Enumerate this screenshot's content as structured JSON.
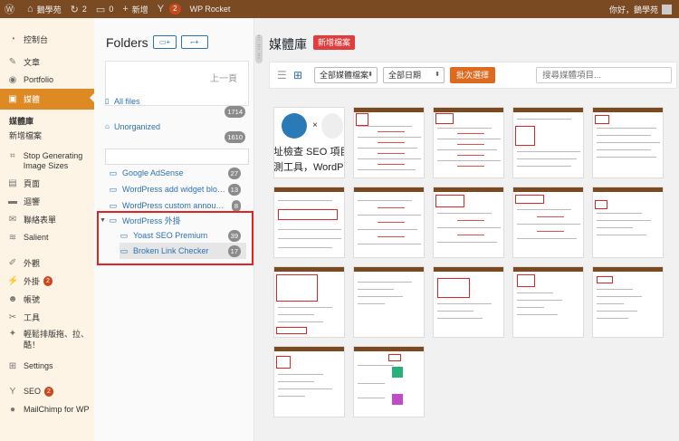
{
  "adminbar": {
    "site_name": "鵝學苑",
    "updates_count": "2",
    "comments_count": "0",
    "new_label": "新增",
    "yoast_count": "2",
    "wp_rocket": "WP Rocket",
    "greeting": "你好，鵝學苑"
  },
  "sidebar": {
    "items": [
      {
        "label": "控制台",
        "icon": "dashboard-icon",
        "glyph": "◔"
      },
      {
        "label": "文章",
        "icon": "pin-icon",
        "glyph": "✎"
      },
      {
        "label": "Portfolio",
        "icon": "portfolio-icon",
        "glyph": "◉"
      },
      {
        "label": "媒體",
        "icon": "media-icon",
        "glyph": "▣"
      },
      {
        "label": "Stop Generating Image Sizes",
        "icon": "crop-icon",
        "glyph": "⌗"
      },
      {
        "label": "頁面",
        "icon": "page-icon",
        "glyph": "▤"
      },
      {
        "label": "迴響",
        "icon": "comment-icon",
        "glyph": "▬"
      },
      {
        "label": "聯絡表單",
        "icon": "mail-icon",
        "glyph": "✉"
      },
      {
        "label": "Salient",
        "icon": "salient-icon",
        "glyph": "≋"
      },
      {
        "label": "外觀",
        "icon": "brush-icon",
        "glyph": "✐"
      },
      {
        "label": "外掛",
        "icon": "plugin-icon",
        "glyph": "⚡",
        "badge": "2"
      },
      {
        "label": "帳號",
        "icon": "user-icon",
        "glyph": "☻"
      },
      {
        "label": "工具",
        "icon": "wrench-icon",
        "glyph": "✂"
      },
      {
        "label": "輕鬆排版拖、拉、酷！",
        "icon": "bulb-icon",
        "glyph": "✦"
      },
      {
        "label": "Settings",
        "icon": "settings-icon",
        "glyph": "⊞"
      },
      {
        "label": "SEO",
        "icon": "yoast-icon",
        "glyph": "Y",
        "badge": "2"
      },
      {
        "label": "MailChimp for WP",
        "icon": "mailchimp-icon",
        "glyph": "●"
      }
    ],
    "submenu": [
      "媒體庫",
      "新增檔案"
    ]
  },
  "folders": {
    "title": "Folders",
    "new_folder_btn": "+",
    "new_sub_btn": "+",
    "prev_label": "上一頁",
    "all_files": {
      "label": "All files",
      "count": "1714"
    },
    "unorganized": {
      "label": "Unorganized",
      "count": "1610"
    },
    "list": [
      {
        "label": "Google AdSense",
        "count": "27"
      },
      {
        "label": "WordPress add widget bloo...",
        "count": "13"
      },
      {
        "label": "WordPress custom announc...",
        "count": "8"
      },
      {
        "label": "WordPress 外掛",
        "count": ""
      },
      {
        "label": "Yoast SEO Premium",
        "count": "39"
      },
      {
        "label": "Broken Link Checker",
        "count": "17"
      }
    ]
  },
  "main": {
    "title": "媒體庫",
    "add_new": "新增檔案",
    "filter_type": "全部媒體檔案",
    "filter_date": "全部日期",
    "bulk_select": "批次選擇",
    "search_placeholder": "搜尋媒體項目...",
    "thumb1_line1": "址檢查 SEO 項目",
    "thumb1_line2": "測工具，WordP"
  },
  "colors": {
    "adminbar": "#7a4b23",
    "accent": "#dd8a25",
    "red_badge": "#e03d3d",
    "link": "#2b72b3"
  }
}
